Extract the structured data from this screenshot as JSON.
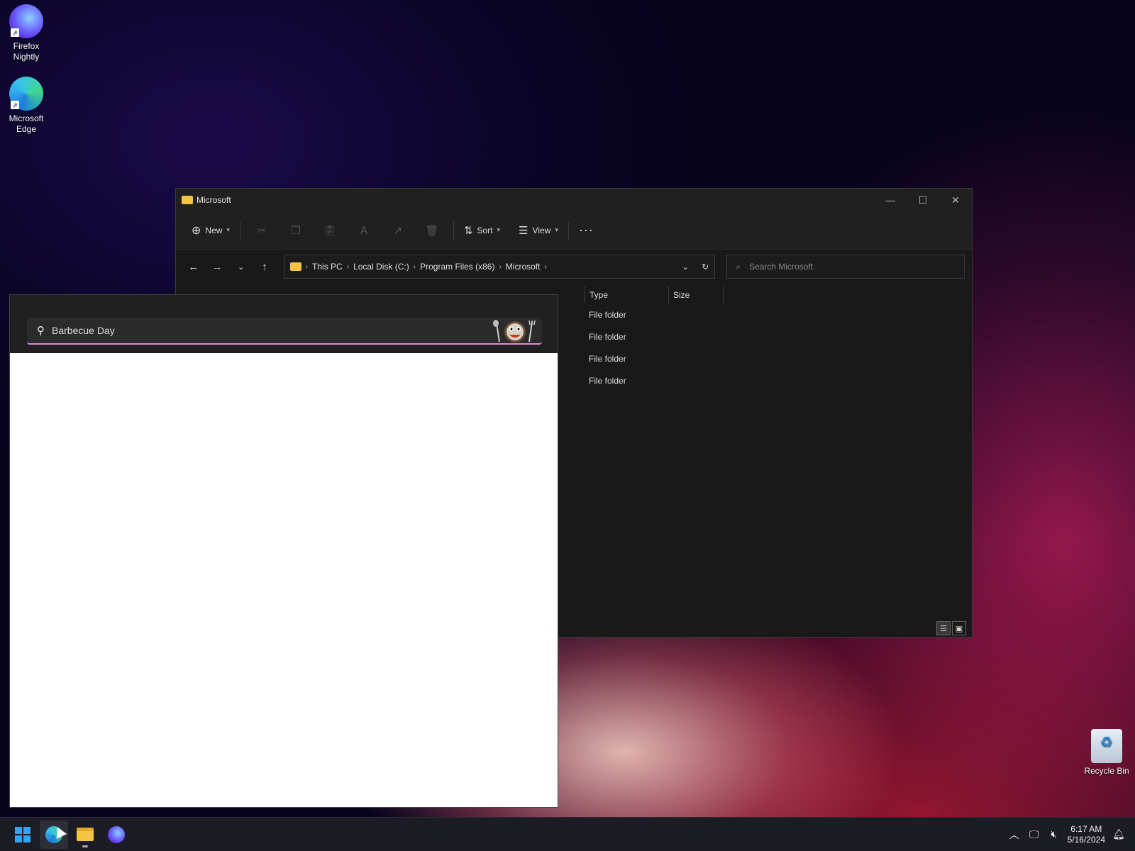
{
  "desktop": {
    "icons": [
      {
        "label_line1": "Firefox",
        "label_line2": "Nightly"
      },
      {
        "label_line1": "Microsoft",
        "label_line2": "Edge"
      }
    ],
    "recycle_bin": "Recycle Bin"
  },
  "explorer": {
    "title": "Microsoft",
    "toolbar": {
      "new_label": "New",
      "sort_label": "Sort",
      "view_label": "View"
    },
    "breadcrumb": [
      "This PC",
      "Local Disk (C:)",
      "Program Files (x86)",
      "Microsoft"
    ],
    "search_placeholder": "Search Microsoft",
    "columns": {
      "type": "Type",
      "size": "Size"
    },
    "rows": [
      {
        "type": "File folder"
      },
      {
        "type": "File folder"
      },
      {
        "type": "File folder"
      },
      {
        "type": "File folder"
      }
    ]
  },
  "search_panel": {
    "query": "Barbecue Day"
  },
  "taskbar": {
    "time": "6:17 AM",
    "date": "5/16/2024"
  },
  "colors": {
    "accent": "#e38ad6",
    "folder": "#f4c542"
  }
}
